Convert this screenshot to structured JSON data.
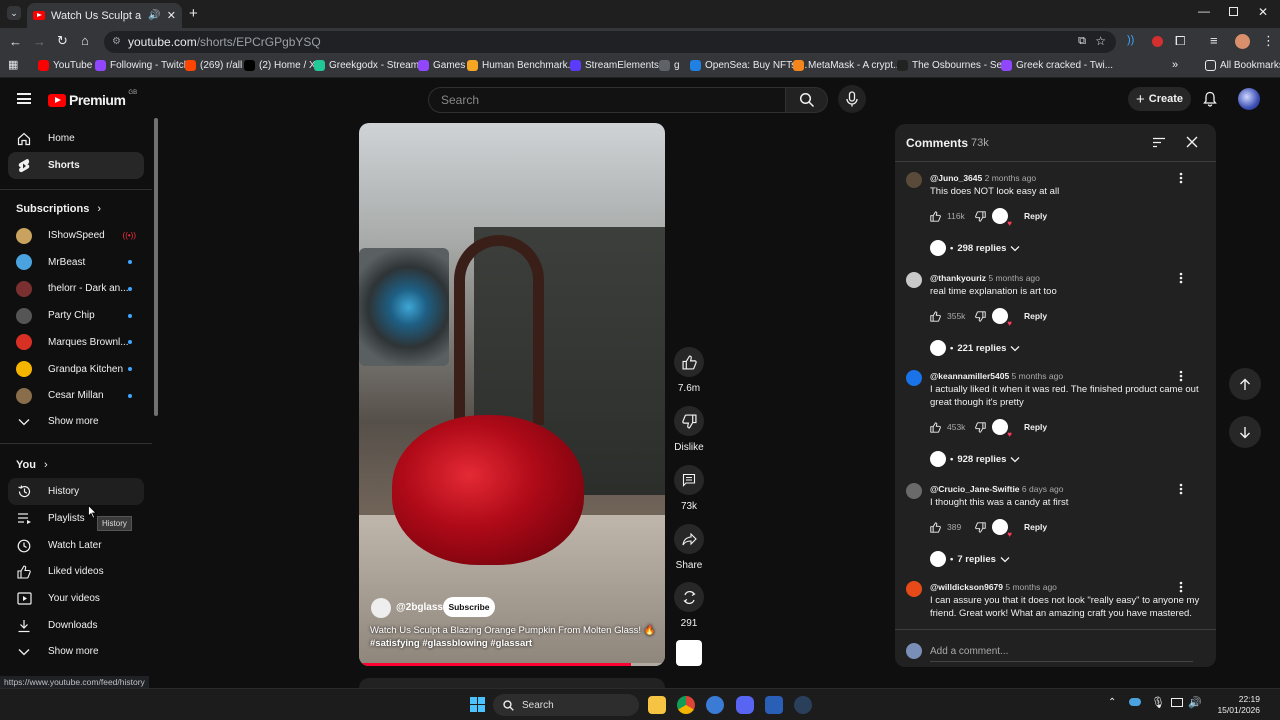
{
  "browser": {
    "tab_title": "Watch Us Sculpt a Blazing O",
    "url_host": "youtube.com",
    "url_path": "/shorts/EPCrGPgbYSQ",
    "bookmarks": [
      {
        "label": "YouTube",
        "color": "#ff0000"
      },
      {
        "label": "Following - Twitch",
        "color": "#9146ff"
      },
      {
        "label": "(269) r/all",
        "color": "#ff4500"
      },
      {
        "label": "(2) Home / X",
        "color": "#000000"
      },
      {
        "label": "Greekgodx - Stream...",
        "color": "#20c997"
      },
      {
        "label": "Games",
        "color": "#9146ff"
      },
      {
        "label": "Human Benchmark...",
        "color": "#f5a623"
      },
      {
        "label": "StreamElements -",
        "color": "#5c3bfe"
      },
      {
        "label": "g",
        "color": "#5f6368"
      },
      {
        "label": "OpenSea: Buy NFTs,...",
        "color": "#2081e2"
      },
      {
        "label": "MetaMask - A crypt...",
        "color": "#f6851b"
      },
      {
        "label": "The Osbournes - Se...",
        "color": "#222222"
      },
      {
        "label": "Greek cracked - Twi...",
        "color": "#9146ff"
      }
    ],
    "all_bookmarks": "All Bookmarks",
    "status_url": "https://www.youtube.com/feed/history"
  },
  "header": {
    "logo": "Premium",
    "region": "GB",
    "search_placeholder": "Search",
    "create_label": "Create"
  },
  "sidebar": {
    "home": "Home",
    "shorts": "Shorts",
    "subscriptions_title": "Subscriptions",
    "subscriptions": [
      {
        "name": "IShowSpeed",
        "color": "#c8a25e",
        "live": true
      },
      {
        "name": "MrBeast",
        "color": "#4aa3df",
        "live": false
      },
      {
        "name": "thelorr - Dark an...",
        "color": "#7a3030",
        "live": false
      },
      {
        "name": "Party Chip",
        "color": "#555555",
        "live": false
      },
      {
        "name": "Marques Brownl...",
        "color": "#d93025",
        "live": false
      },
      {
        "name": "Grandpa Kitchen",
        "color": "#f4b400",
        "live": false
      },
      {
        "name": "Cesar Millan",
        "color": "#8a6d4a",
        "live": false
      }
    ],
    "show_more": "Show more",
    "you_title": "You",
    "you_items": [
      "History",
      "Playlists",
      "Watch Later",
      "Liked videos",
      "Your videos",
      "Downloads"
    ],
    "show_more_2": "Show more",
    "tooltip": "History"
  },
  "video": {
    "channel": "@2bglass",
    "subscribe": "Subscribe",
    "title": "Watch Us Sculpt a Blazing Orange Pumpkin From Molten Glass! 🔥",
    "hashtags": "#satisfying #glassblowing  #glassart",
    "progress": 0.89,
    "likes": "7.6m",
    "dislike": "Dislike",
    "comments": "73k",
    "share": "Share",
    "remix": "291"
  },
  "comments": {
    "title": "Comments",
    "count": "73k",
    "reply_label": "Reply",
    "items": [
      {
        "user": "@Juno_3645",
        "time": "2 months ago",
        "text": "This does NOT look easy at all",
        "likes": "116k",
        "replies": "298 replies",
        "avatar": "#5a4a3a"
      },
      {
        "user": "@thankyouriz",
        "time": "5 months ago",
        "text": "real time explanation is art too",
        "likes": "355k",
        "replies": "221 replies",
        "avatar": "#c9c9c9"
      },
      {
        "user": "@keannamiller5405",
        "time": "5 months ago",
        "text": "I actually liked it when it was red. The finished product came out great though it's pretty",
        "likes": "453k",
        "replies": "928 replies",
        "avatar": "#1a73e8"
      },
      {
        "user": "@Crucio_Jane-Swiftie",
        "time": "6 days ago",
        "text": "I thought this was a candy at first",
        "likes": "389",
        "replies": "7 replies",
        "avatar": "#6a6a6a"
      },
      {
        "user": "@willdickson9679",
        "time": "5 months ago",
        "text": "I can assure you that it does not look \"really easy\" to anyone my friend. Great work! What an amazing craft you have mastered.",
        "avatar": "#e64a19"
      }
    ],
    "add_placeholder": "Add a comment..."
  },
  "taskbar": {
    "search": "Search",
    "time": "22:19",
    "date": "15/01/2026"
  }
}
